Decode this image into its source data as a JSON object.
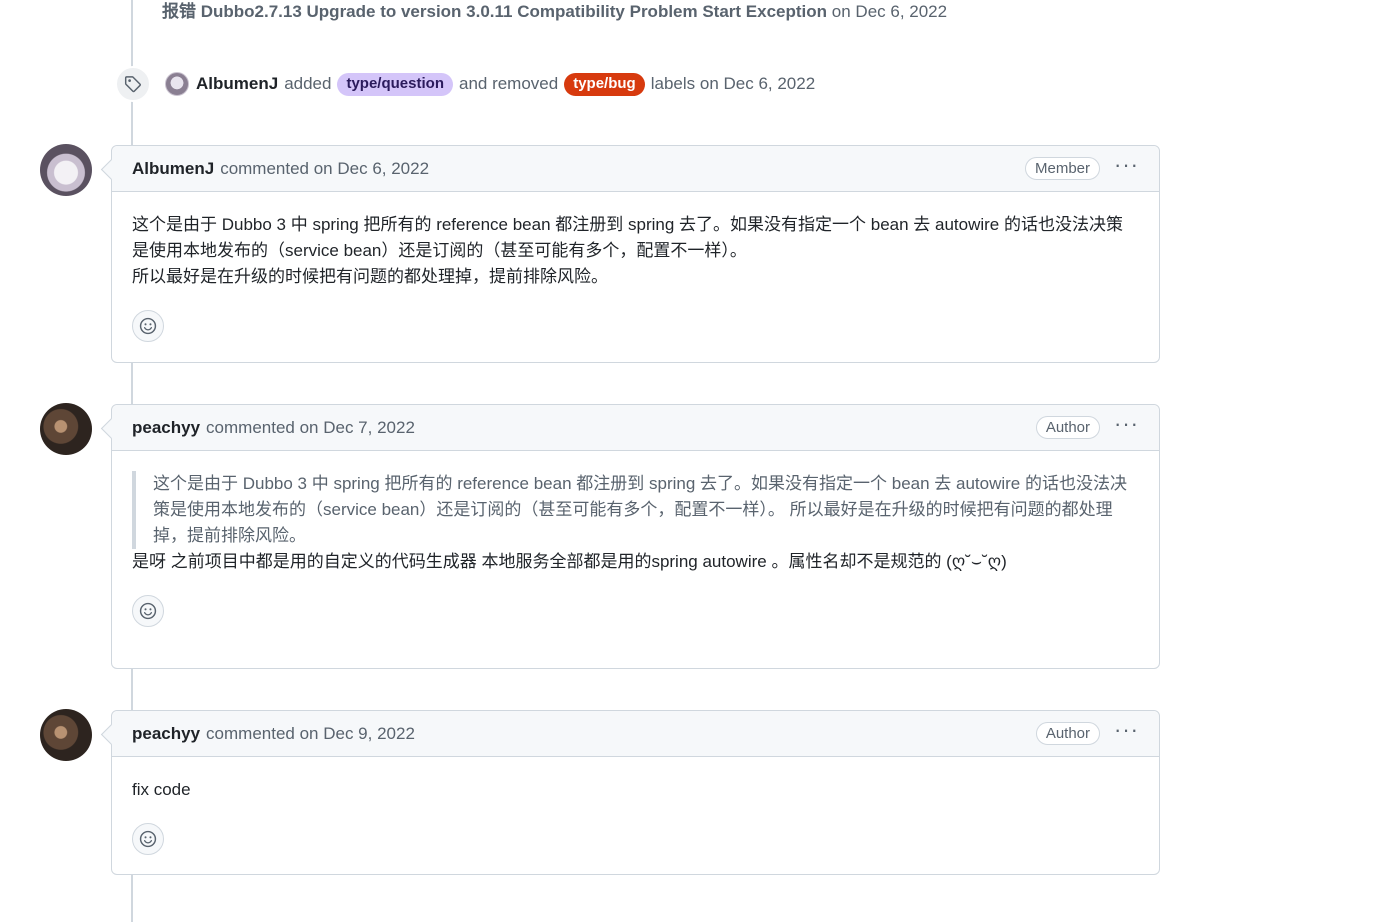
{
  "referenced_event": {
    "title": "报错 Dubbo2.7.13 Upgrade to version 3.0.11 Compatibility Problem Start Exception",
    "date": "on Dec 6, 2022"
  },
  "label_event": {
    "icon": "tag-icon",
    "actor": "AlbumenJ",
    "added_text": "added",
    "added_label": "type/question",
    "removed_text": "and removed",
    "removed_label": "type/bug",
    "suffix": "labels on Dec 6, 2022",
    "colors": {
      "question_bg": "#d4c5f9",
      "bug_bg": "#d73a0e"
    }
  },
  "comments": [
    {
      "author": "AlbumenJ",
      "action": "commented on Dec 6, 2022",
      "role": "Member",
      "menu": "···",
      "body": [
        "这个是由于 Dubbo 3 中 spring 把所有的 reference bean 都注册到 spring 去了。如果没有指定一个 bean 去 autowire 的话也没法决策是使用本地发布的（service bean）还是订阅的（甚至可能有多个，配置不一样）。",
        "所以最好是在升级的时候把有问题的都处理掉，提前排除风险。"
      ],
      "reaction_icon": "smiley-icon"
    },
    {
      "author": "peachyy",
      "action": "commented on Dec 7, 2022",
      "role": "Author",
      "menu": "···",
      "quote": "这个是由于 Dubbo 3 中 spring 把所有的 reference bean 都注册到 spring 去了。如果没有指定一个 bean 去 autowire 的话也没法决策是使用本地发布的（service bean）还是订阅的（甚至可能有多个，配置不一样）。 所以最好是在升级的时候把有问题的都处理掉，提前排除风险。",
      "body": "是呀 之前项目中都是用的自定义的代码生成器 本地服务全部都是用的spring autowire 。属性名却不是规范的 (ღ˘⌣˘ღ)",
      "reaction_icon": "smiley-icon"
    },
    {
      "author": "peachyy",
      "action": "commented on Dec 9, 2022",
      "role": "Author",
      "menu": "···",
      "body": "fix code",
      "reaction_icon": "smiley-icon"
    }
  ]
}
